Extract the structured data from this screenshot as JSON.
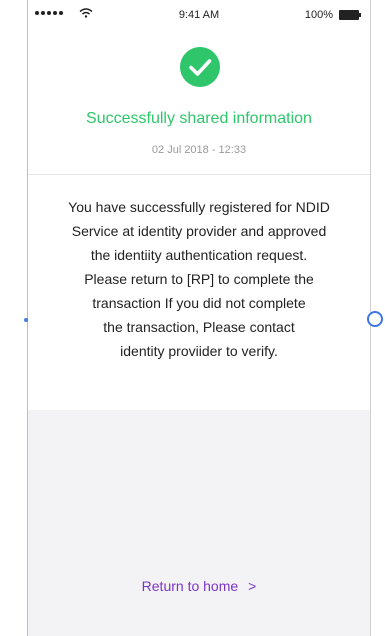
{
  "status_bar": {
    "time": "9:41 AM",
    "battery_percent": "100%",
    "signal_icon": "signal-dots-icon",
    "wifi_icon": "wifi-icon",
    "battery_icon": "battery-icon"
  },
  "header": {
    "icon": "check-circle-icon",
    "title": "Successfully shared information",
    "date": "02 Jul 2018 - 12:33"
  },
  "message": {
    "lines": [
      "You have successfully registered for NDID",
      "Service at identity provider and approved",
      "the identiity authentication request.",
      "Please return to [RP] to complete the",
      "transaction If you did not complete",
      "the transaction, Please contact",
      "identity proviider to verify."
    ]
  },
  "footer": {
    "return_label": "Return to home",
    "return_icon": "chevron-right-icon",
    "return_chevron": ">"
  },
  "colors": {
    "success": "#2fc66b",
    "link": "#7b36c7",
    "background_bottom": "#f3f2f5"
  }
}
